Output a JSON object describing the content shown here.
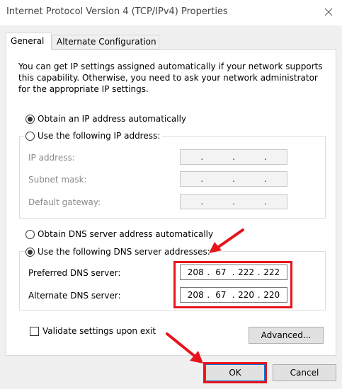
{
  "window": {
    "title": "Internet Protocol Version 4 (TCP/IPv4) Properties"
  },
  "tabs": [
    {
      "label": "General",
      "active": true
    },
    {
      "label": "Alternate Configuration",
      "active": false
    }
  ],
  "description": "You can get IP settings assigned automatically if your network supports this capability. Otherwise, you need to ask your network administrator for the appropriate IP settings.",
  "ip_options": {
    "auto_label": "Obtain an IP address automatically",
    "auto_access_key": "O",
    "manual_label": "Use the following IP address:",
    "manual_access_key": "s",
    "selected": "auto"
  },
  "ip_fields": {
    "ip_address": {
      "label": "IP address:",
      "value": ". . ."
    },
    "subnet_mask": {
      "label": "Subnet mask:",
      "value": ". . ."
    },
    "default_gateway": {
      "label": "Default gateway:",
      "value": ". . ."
    }
  },
  "dns_options": {
    "auto_label": "Obtain DNS server address automatically",
    "manual_label": "Use the following DNS server addresses:",
    "selected": "manual"
  },
  "dns_fields": {
    "preferred": {
      "label": "Preferred DNS server:",
      "octets": [
        "208",
        "67",
        "222",
        "222"
      ]
    },
    "alternate": {
      "label": "Alternate DNS server:",
      "octets": [
        "208",
        "67",
        "220",
        "220"
      ]
    }
  },
  "validate_label": "Validate settings upon exit",
  "buttons": {
    "advanced": "Advanced...",
    "ok": "OK",
    "cancel": "Cancel"
  },
  "colors": {
    "highlight": "#e8141b",
    "accent": "#0078d7"
  }
}
